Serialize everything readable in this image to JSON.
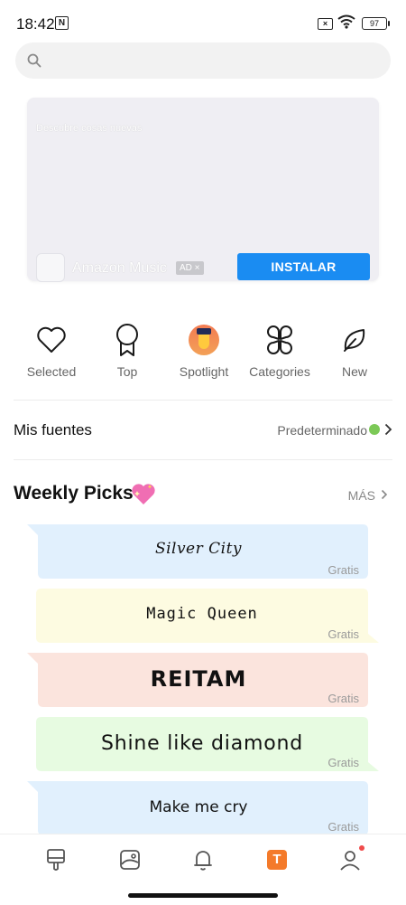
{
  "status_bar": {
    "time": "18:42",
    "nfc_label": "N",
    "battery": "97"
  },
  "search": {
    "placeholder": ""
  },
  "ad": {
    "caption": "Descubre cosas nuevas",
    "app_name": "Amazon Music",
    "badge": "AD ×",
    "install_label": "INSTALAR"
  },
  "categories": [
    {
      "label": "Selected",
      "icon": "heart-icon"
    },
    {
      "label": "Top",
      "icon": "medal-icon"
    },
    {
      "label": "Spotlight",
      "icon": "spotlight-avatar-icon"
    },
    {
      "label": "Categories",
      "icon": "grid-flower-icon"
    },
    {
      "label": "New",
      "icon": "leaf-icon"
    }
  ],
  "fonts": {
    "title": "Mis fuentes",
    "value": "Predeterminado"
  },
  "weekly": {
    "title": "Weekly Picks",
    "more": "MÁS",
    "picks": [
      {
        "title": "Silver City",
        "price": "Gratis",
        "color": "#e1f0fd"
      },
      {
        "title": "Magic Queen",
        "price": "Gratis",
        "color": "#fdfbe1"
      },
      {
        "title": "REITAM",
        "price": "Gratis",
        "color": "#fbe4dd"
      },
      {
        "title": "Shine like diamond",
        "price": "Gratis",
        "color": "#e7fbe1"
      },
      {
        "title": "Make me cry",
        "price": "Gratis",
        "color": "#e1f0fd"
      }
    ]
  },
  "nav": [
    {
      "icon": "paint-brush-icon"
    },
    {
      "icon": "wallpaper-icon"
    },
    {
      "icon": "bell-icon"
    },
    {
      "icon": "fonts-tab-icon",
      "label": "T"
    },
    {
      "icon": "profile-icon"
    }
  ]
}
